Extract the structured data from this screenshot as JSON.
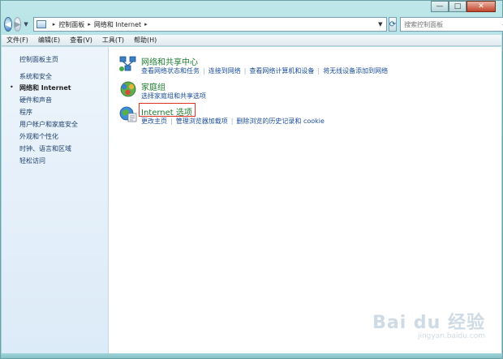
{
  "window": {
    "caption_buttons": {
      "minimize": "—",
      "maximize": "□",
      "close": "✕"
    }
  },
  "address_bar": {
    "breadcrumbs": [
      "控制面板",
      "网络和 Internet"
    ],
    "search_placeholder": "搜索控制面板"
  },
  "menu": {
    "items": [
      "文件(F)",
      "编辑(E)",
      "查看(V)",
      "工具(T)",
      "帮助(H)"
    ]
  },
  "left_pane": {
    "home": "控制面板主页",
    "items": [
      "系统和安全",
      "网络和 Internet",
      "硬件和声音",
      "程序",
      "用户帐户和家庭安全",
      "外观和个性化",
      "时钟、语言和区域",
      "轻松访问"
    ],
    "active_index": 1
  },
  "categories": [
    {
      "title": "网络和共享中心",
      "links": [
        "查看网络状态和任务",
        "连接到网络",
        "查看网络计算机和设备",
        "将无线设备添加到网络"
      ],
      "icon": "network-icon"
    },
    {
      "title": "家庭组",
      "links": [
        "选择家庭组和共享选项"
      ],
      "icon": "homegroup-icon"
    },
    {
      "title": "Internet 选项",
      "links": [
        "更改主页",
        "管理浏览器加载项",
        "删除浏览的历史记录和 cookie"
      ],
      "icon": "internet-options-icon",
      "highlighted": true
    }
  ],
  "watermark": {
    "logo": "Bai du 经验",
    "sub": "jingyan.baidu.com"
  },
  "colors": {
    "category_title": "#1e7d2f",
    "link": "#1a4d9c",
    "highlight": "#e03325",
    "frame": "#a4d7dc"
  }
}
